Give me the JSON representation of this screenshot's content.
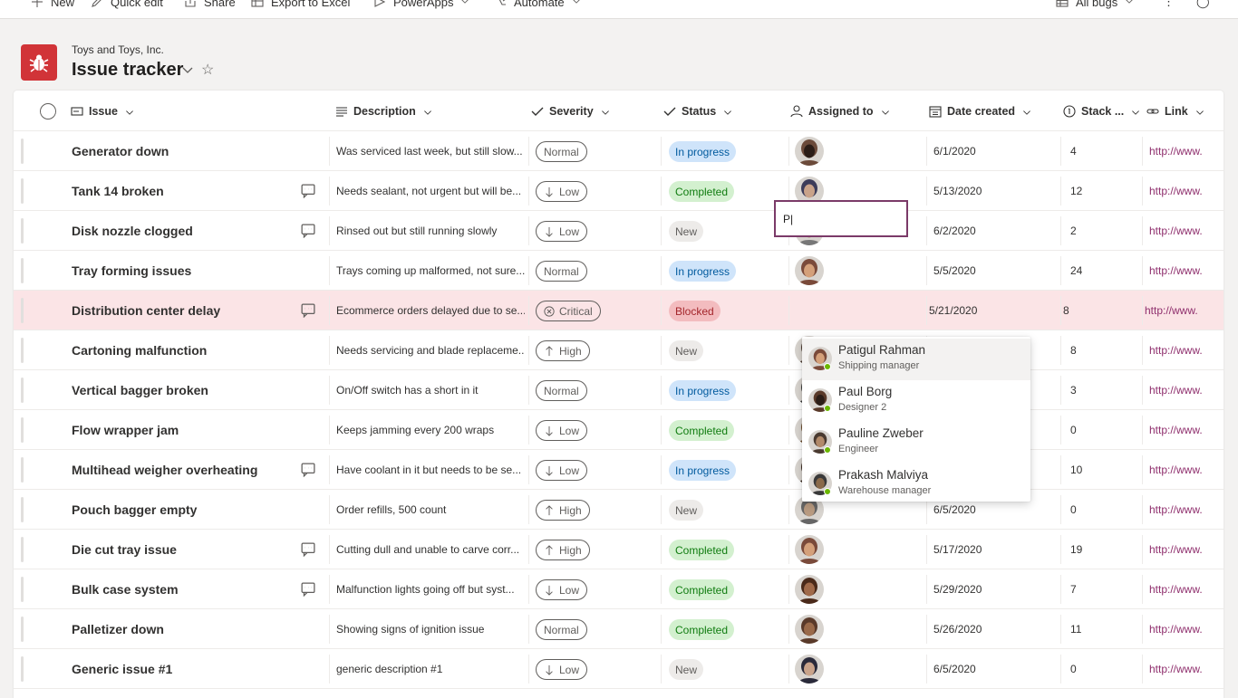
{
  "command_bar": {
    "items": [
      {
        "label": "New",
        "icon": "plus-icon",
        "has_chevron": false
      },
      {
        "label": "Quick edit",
        "icon": "pencil-icon",
        "has_chevron": false
      },
      {
        "label": "Share",
        "icon": "share-icon",
        "has_chevron": false
      },
      {
        "label": "Export to Excel",
        "icon": "excel-icon",
        "has_chevron": false
      },
      {
        "label": "PowerApps",
        "icon": "powerapps-icon",
        "has_chevron": true
      },
      {
        "label": "Automate",
        "icon": "flow-icon",
        "has_chevron": true
      }
    ],
    "view_label": "All bugs"
  },
  "site": {
    "org": "Toys and Toys, Inc.",
    "title": "Issue tracker",
    "logo_icon": "bug-icon",
    "logo_color": "#d13438"
  },
  "columns": [
    {
      "label": "Issue",
      "icon": "text-icon"
    },
    {
      "label": "Description",
      "icon": "multiline-icon"
    },
    {
      "label": "Severity",
      "icon": "check-icon"
    },
    {
      "label": "Status",
      "icon": "check-icon"
    },
    {
      "label": "Assigned to",
      "icon": "person-icon"
    },
    {
      "label": "Date created",
      "icon": "calendar-icon"
    },
    {
      "label": "Stack ...",
      "icon": "number-icon"
    },
    {
      "label": "Link",
      "icon": "link-icon"
    }
  ],
  "rows": [
    {
      "issue": "Generator down",
      "comment": false,
      "description": "Was serviced last week, but still slow...",
      "severity": "Normal",
      "status": "In progress",
      "date": "6/1/2020",
      "stack": "4",
      "link": "http://www."
    },
    {
      "issue": "Tank 14 broken",
      "comment": true,
      "description": "Needs sealant, not urgent but will be...",
      "severity": "Low",
      "status": "Completed",
      "date": "5/13/2020",
      "stack": "12",
      "link": "http://www."
    },
    {
      "issue": "Disk nozzle clogged",
      "comment": true,
      "description": "Rinsed out but still running slowly",
      "severity": "Low",
      "status": "New",
      "date": "6/2/2020",
      "stack": "2",
      "link": "http://www."
    },
    {
      "issue": "Tray forming issues",
      "comment": false,
      "description": "Trays coming up malformed, not sure...",
      "severity": "Normal",
      "status": "In progress",
      "date": "5/5/2020",
      "stack": "24",
      "link": "http://www."
    },
    {
      "issue": "Distribution center delay",
      "comment": true,
      "description": "Ecommerce orders delayed due to se...",
      "severity": "Critical",
      "status": "Blocked",
      "date": "5/21/2020",
      "stack": "8",
      "link": "http://www."
    },
    {
      "issue": "Cartoning malfunction",
      "comment": false,
      "description": "Needs servicing and blade replaceme...",
      "severity": "High",
      "status": "New",
      "date": "",
      "stack": "8",
      "link": "http://www."
    },
    {
      "issue": "Vertical bagger broken",
      "comment": false,
      "description": "On/Off switch has a short in it",
      "severity": "Normal",
      "status": "In progress",
      "date": "",
      "stack": "3",
      "link": "http://www."
    },
    {
      "issue": "Flow wrapper jam",
      "comment": false,
      "description": "Keeps jamming every 200 wraps",
      "severity": "Low",
      "status": "Completed",
      "date": "",
      "stack": "0",
      "link": "http://www."
    },
    {
      "issue": "Multihead weigher overheating",
      "comment": true,
      "description": "Have coolant in it but needs to be se...",
      "severity": "Low",
      "status": "In progress",
      "date": "",
      "stack": "10",
      "link": "http://www."
    },
    {
      "issue": "Pouch bagger empty",
      "comment": false,
      "description": "Order refills, 500 count",
      "severity": "High",
      "status": "New",
      "date": "6/5/2020",
      "stack": "0",
      "link": "http://www."
    },
    {
      "issue": "Die cut tray issue",
      "comment": true,
      "description": "Cutting dull and unable to carve corr...",
      "severity": "High",
      "status": "Completed",
      "date": "5/17/2020",
      "stack": "19",
      "link": "http://www."
    },
    {
      "issue": "Bulk case system",
      "comment": true,
      "description": "Malfunction lights going off but syst...",
      "severity": "Low",
      "status": "Completed",
      "date": "5/29/2020",
      "stack": "7",
      "link": "http://www."
    },
    {
      "issue": "Palletizer down",
      "comment": false,
      "description": "Showing signs of ignition issue",
      "severity": "Normal",
      "status": "Completed",
      "date": "5/26/2020",
      "stack": "11",
      "link": "http://www."
    },
    {
      "issue": "Generic issue #1",
      "comment": false,
      "description": "generic description #1",
      "severity": "Low",
      "status": "New",
      "date": "6/5/2020",
      "stack": "0",
      "link": "http://www."
    }
  ],
  "editing": {
    "row": 4,
    "value": "P|"
  },
  "people_picker": [
    {
      "name": "Patigul Rahman",
      "role": "Shipping manager"
    },
    {
      "name": "Paul Borg",
      "role": "Designer 2"
    },
    {
      "name": "Pauline Zweber",
      "role": "Engineer"
    },
    {
      "name": "Prakash Malviya",
      "role": "Warehouse manager"
    }
  ],
  "colors": {
    "status": {
      "In progress": {
        "bg": "#cfe4fa",
        "fg": "#005a9e"
      },
      "Completed": {
        "bg": "#d3f0cf",
        "fg": "#107c10"
      },
      "New": {
        "bg": "#edebe9",
        "fg": "#605e5c"
      },
      "Blocked": {
        "bg": "#f3bcbf",
        "fg": "#a4262c"
      }
    },
    "selected_row": "#fbe4e6",
    "link": "#8f2f6d"
  }
}
